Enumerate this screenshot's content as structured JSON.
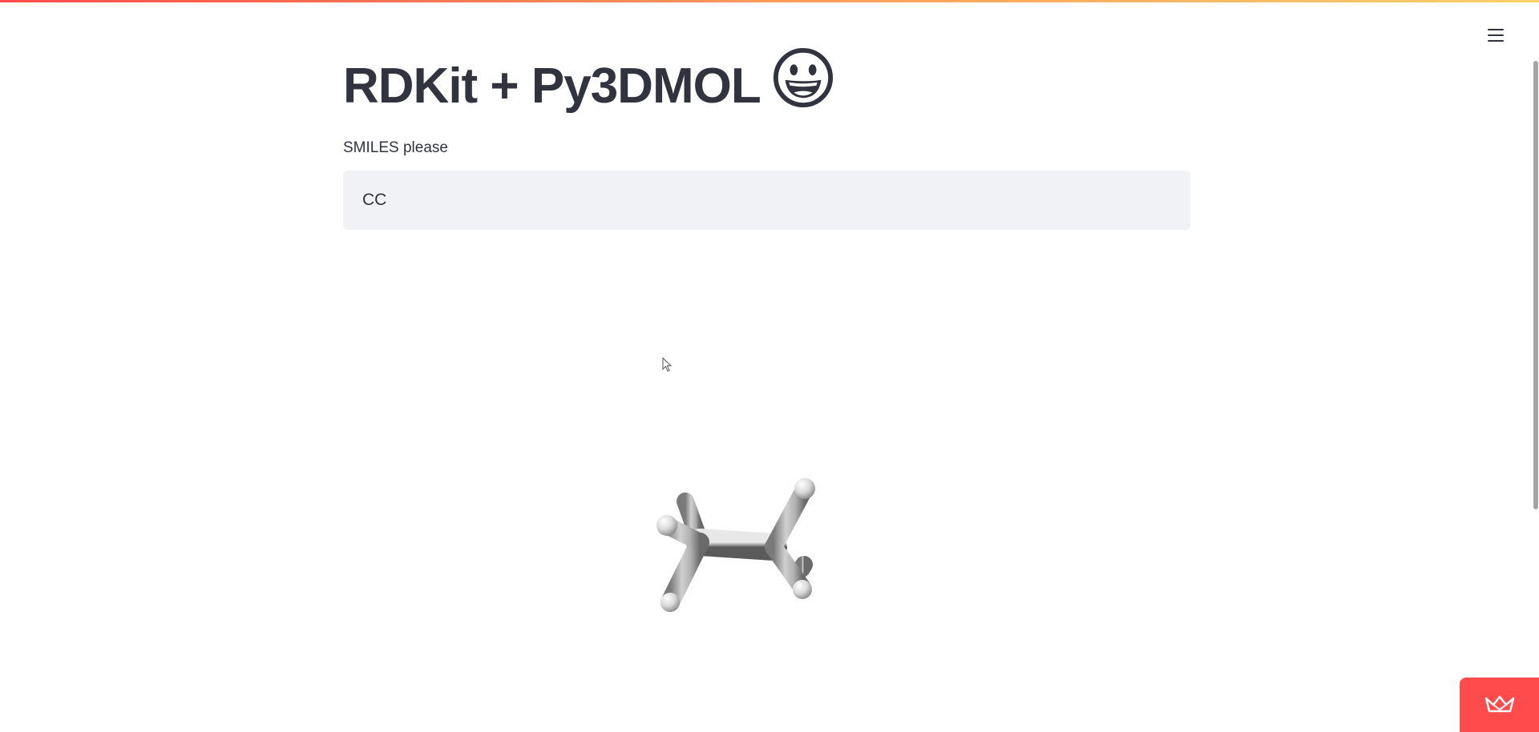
{
  "app": {
    "title": "RDKit + Py3DMOL",
    "title_emoji": "grinning-face-emoji"
  },
  "menu": {
    "icon": "hamburger-menu-icon"
  },
  "input": {
    "label": "SMILES please",
    "value": "CC"
  },
  "viewer": {
    "molecule": "ethane",
    "style": "stick",
    "atom_color": "#d8d8d8"
  },
  "footer": {
    "icon": "streamlit-crown-icon",
    "accent_color": "#ff4b4b"
  },
  "colors": {
    "text": "#31333f",
    "input_background": "#f0f2f6",
    "accent": "#ff4b4b"
  }
}
